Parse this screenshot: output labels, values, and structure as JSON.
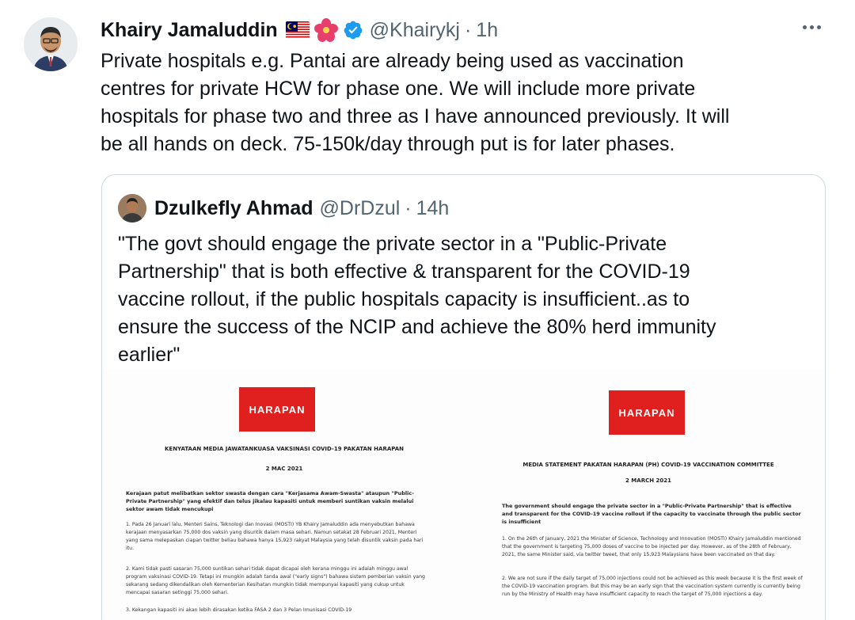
{
  "tweet": {
    "author_name": "Khairy Jamaluddin",
    "handle": "@Khairykj",
    "separator": "·",
    "time": "1h",
    "text": "Private hospitals e.g. Pantai are already being used as vaccination\ncentres for private HCW for phase one. We will include more private\nhospitals for phase two and three as I have announced previously. It will\nbe all hands on deck. 75-150k/day through put is for later phases."
  },
  "quoted_tweet": {
    "author_name": "Dzulkefly Ahmad",
    "handle": "@DrDzul",
    "separator": "·",
    "time": "14h",
    "text": "\"The govt should engage the private sector in a \"Public-Private\nPartnership\" that is both effective & transparent for the COVID-19\nvaccine rollout, if the public hospitals capacity is insufficient..as to\nensure the success of the NCIP and achieve the 80% herd immunity\nearlier\""
  },
  "documents": [
    {
      "logo": "HARAPAN",
      "title": "KENYATAAN MEDIA JAWATANKUASA VAKSINASI COVID-19 PAKATAN HARAPAN",
      "date": "2 MAC 2021",
      "lead": "Kerajaan patut melibatkan sektor swasta dengan cara \"Kerjasama Awam-Swasta\" ataupun \"Public-Private Partnership\" yang efektif dan telus jikalau kapasiti untuk memberi suntikan vaksin melalui sektor awam tidak mencukupi",
      "para1": "1. Pada 26 Januari lalu, Menteri Sains, Teknologi dan Inovasi (MOSTI) YB Khairy Jamaluddin ada menyebutkan bahawa kerajaan menyasarkan 75,000 dos vaksin yang disuntik dalam masa sehari. Namun setakat 28 Februari 2021, Menteri yang sama melepaskan ciapan twitter beliau bahawa hanya 15,923 rakyat Malaysia yang telah disuntik vaksin pada hari itu.",
      "para2": "2. Kami tidak pasti sasaran 75,000 suntikan sehari tidak dapat dicapai oleh kerana minggu ini adalah minggu awal program vaksinasi COVID-19. Tetapi ini mungkin adalah tanda awal (\"early signs\") bahawa sistem pemberian vaksin yang sekarang sedang dikendalikan oleh Kementerian Kesihatan mungkin tidak mempunyai kapasiti yang cukup untuk mencapai sasaran setinggi 75,000 sehari.",
      "para3": "3. Kekangan kapasiti ini akan lebih dirasakan ketika FASA 2 dan 3 Pelan Imunisasi COVID-19"
    },
    {
      "logo": "HARAPAN",
      "title": "MEDIA STATEMENT PAKATAN HARAPAN (PH) COVID-19 VACCINATION COMMITTEE",
      "date": "2 MARCH 2021",
      "lead": "The government should engage the private sector in a \"Public-Private Partnership\" that is effective and transparent for the COVID-19 vaccine rollout if the capacity to vaccinate through the public sector is insufficient",
      "para1": "1. On the 26th of January, 2021 the Minister of Science, Technology and Innovation (MOSTI) Khairy Jamaluddin mentioned that the government is targeting 75,000 doses of vaccine to be injected per day. However, as of the 28th of February, 2021, the same Minister said, via twitter tweet, that only 15,923 Malaysians have been vaccinated on that day.",
      "para2": "2. We are not sure if the daily target of 75,000 injections could not be achieved as this week because it is the first week of the COVID-19 vaccination program. But this may be an early sign that the vaccination system currently is currently being run by the Ministry of Health may have insufficient capacity to reach the target of 75,000 injections a day."
    }
  ],
  "icons": {
    "flag": "malaysia-flag-icon",
    "flower": "hibiscus-icon",
    "verified": "verified-badge-icon",
    "more": "more-options-icon"
  },
  "colors": {
    "accent_blue": "#1d9bf0",
    "secondary_text": "#536471",
    "border": "#cfd9de",
    "harapan_red": "#e0201f"
  }
}
